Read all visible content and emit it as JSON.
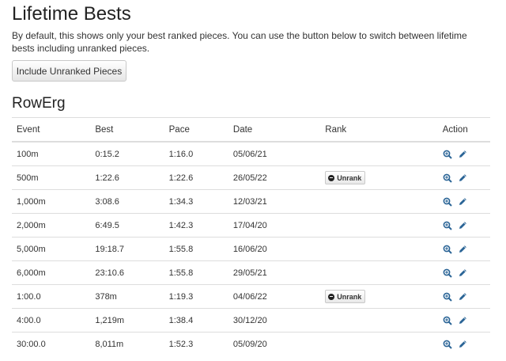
{
  "page": {
    "title": "Lifetime Bests",
    "description": "By default, this shows only your best ranked pieces. You can use the button below to switch between lifetime bests including unranked pieces.",
    "toggle_button": "Include Unranked Pieces"
  },
  "section": {
    "title": "RowErg"
  },
  "table": {
    "headers": [
      "Event",
      "Best",
      "Pace",
      "Date",
      "Rank",
      "Action"
    ],
    "unrank_label": "Unrank",
    "rows": [
      {
        "event": "100m",
        "best": "0:15.2",
        "pace": "1:16.0",
        "date": "05/06/21",
        "rank": ""
      },
      {
        "event": "500m",
        "best": "1:22.6",
        "pace": "1:22.6",
        "date": "26/05/22",
        "rank": "Unrank"
      },
      {
        "event": "1,000m",
        "best": "3:08.6",
        "pace": "1:34.3",
        "date": "12/03/21",
        "rank": ""
      },
      {
        "event": "2,000m",
        "best": "6:49.5",
        "pace": "1:42.3",
        "date": "17/04/20",
        "rank": ""
      },
      {
        "event": "5,000m",
        "best": "19:18.7",
        "pace": "1:55.8",
        "date": "16/06/20",
        "rank": ""
      },
      {
        "event": "6,000m",
        "best": "23:10.6",
        "pace": "1:55.8",
        "date": "29/05/21",
        "rank": ""
      },
      {
        "event": "1:00.0",
        "best": "378m",
        "pace": "1:19.3",
        "date": "04/06/22",
        "rank": "Unrank"
      },
      {
        "event": "4:00.0",
        "best": "1,219m",
        "pace": "1:38.4",
        "date": "30/12/20",
        "rank": ""
      },
      {
        "event": "30:00.0",
        "best": "8,011m",
        "pace": "1:52.3",
        "date": "05/09/20",
        "rank": ""
      }
    ]
  },
  "icons": {
    "view": "zoom-in-icon",
    "edit": "pencil-icon"
  },
  "colors": {
    "icon_blue": "#2a6496",
    "border": "#dddddd",
    "text": "#333333"
  }
}
